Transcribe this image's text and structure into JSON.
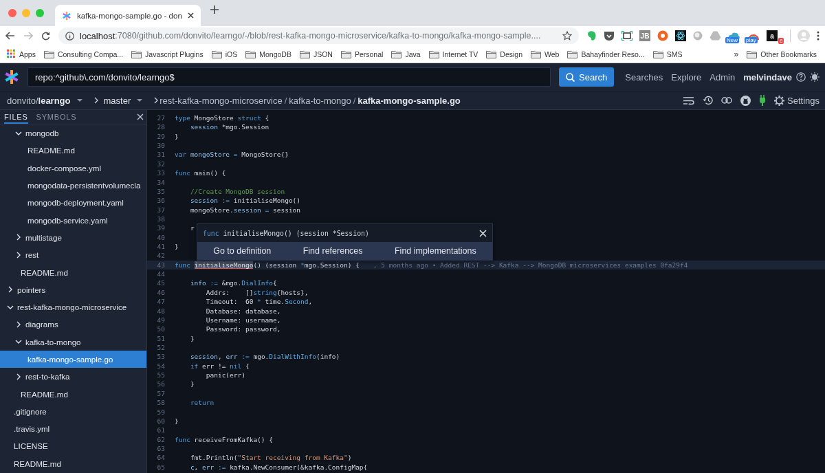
{
  "browser": {
    "tab": {
      "title": "kafka-mongo-sample.go - don"
    },
    "address": {
      "host": "localhost",
      "rest": ":7080/github.com/donvito/learngo/-/blob/rest-kafka-mongo-microservice/kafka-to-mongo/kafka-mongo-sample...."
    },
    "extensions": [
      {
        "kind": "elephant"
      },
      {
        "kind": "shield"
      },
      {
        "kind": "frame"
      },
      {
        "kind": "tile",
        "label": "JB"
      },
      {
        "kind": "lifebuoy"
      },
      {
        "kind": "atom"
      },
      {
        "kind": "orb"
      },
      {
        "kind": "triangle"
      },
      {
        "kind": "cloud",
        "badge": "New"
      },
      {
        "kind": "rainbow",
        "badge": "play"
      },
      {
        "kind": "tile",
        "label": "a",
        "badge": "8"
      }
    ],
    "bookmarks": [
      {
        "kind": "apps",
        "label": "Apps"
      },
      {
        "kind": "folder",
        "label": "Consulting Compa..."
      },
      {
        "kind": "folder",
        "label": "Javascript Plugins"
      },
      {
        "kind": "folder",
        "label": "iOS"
      },
      {
        "kind": "folder",
        "label": "MongoDB"
      },
      {
        "kind": "folder",
        "label": "JSON"
      },
      {
        "kind": "folder",
        "label": "Personal"
      },
      {
        "kind": "folder",
        "label": "Java"
      },
      {
        "kind": "folder",
        "label": "Internet TV"
      },
      {
        "kind": "folder",
        "label": "Design"
      },
      {
        "kind": "folder",
        "label": "Web"
      },
      {
        "kind": "folder",
        "label": "Bahayfinder Reso..."
      },
      {
        "kind": "folder",
        "label": "SMS"
      }
    ],
    "bookmarks_more": "»",
    "other_bookmarks": "Other Bookmarks"
  },
  "navbar": {
    "search_value": "repo:^github\\.com/donvito/learngo$",
    "search_button": "Search",
    "links": [
      "Searches",
      "Explore",
      "Admin"
    ],
    "user": "melvindave"
  },
  "repo_bar": {
    "repo": "donvito/**learngo**",
    "branch": "master",
    "path": [
      "rest-kafka-mongo-microservice",
      "kafka-to-mongo",
      "kafka-mongo-sample.go"
    ],
    "path_separator": "/",
    "settings": "Settings"
  },
  "sidebar": {
    "tabs": [
      {
        "label": "FILES",
        "selected": true
      },
      {
        "label": "SYMBOLS",
        "selected": false
      }
    ],
    "tree": [
      {
        "kind": "hidden-parent",
        "children": [
          {
            "label": "mongodb",
            "kind": "folder",
            "expanded": true,
            "selected": false,
            "children": [
              {
                "label": "README.md",
                "kind": "file",
                "selected": false
              },
              {
                "label": "docker-compose.yml",
                "kind": "file",
                "selected": false
              },
              {
                "label": "mongodata-persistentvolumecla",
                "kind": "file",
                "selected": false
              },
              {
                "label": "mongodb-deployment.yaml",
                "kind": "file",
                "selected": false
              },
              {
                "label": "mongodb-service.yaml",
                "kind": "file",
                "selected": false
              }
            ]
          },
          {
            "label": "multistage",
            "kind": "folder",
            "expanded": false,
            "selected": false
          },
          {
            "label": "rest",
            "kind": "folder",
            "expanded": false,
            "selected": false
          },
          {
            "label": "README.md",
            "kind": "file",
            "selected": false
          }
        ]
      },
      {
        "label": "pointers",
        "kind": "folder",
        "expanded": false,
        "selected": false
      },
      {
        "label": "rest-kafka-mongo-microservice",
        "kind": "folder",
        "expanded": true,
        "selected": false,
        "children": [
          {
            "label": "diagrams",
            "kind": "folder",
            "expanded": false,
            "selected": false
          },
          {
            "label": "kafka-to-mongo",
            "kind": "folder",
            "expanded": true,
            "selected": false,
            "children": [
              {
                "label": "kafka-mongo-sample.go",
                "kind": "file",
                "selected": true
              }
            ]
          },
          {
            "label": "rest-to-kafka",
            "kind": "folder",
            "expanded": false,
            "selected": false
          },
          {
            "label": "README.md",
            "kind": "file",
            "selected": false
          }
        ]
      },
      {
        "label": ".gitignore",
        "kind": "file",
        "selected": false
      },
      {
        "label": ".travis.yml",
        "kind": "file",
        "selected": false
      },
      {
        "label": "LICENSE",
        "kind": "file",
        "selected": false
      },
      {
        "label": "README.md",
        "kind": "file",
        "selected": false
      }
    ]
  },
  "code": {
    "lines": [
      {
        "number": "27",
        "highlighted": false,
        "tokens": [
          {
            "kind": "keyword",
            "text": "type"
          },
          {
            "kind": "plain",
            "text": " MongoStore "
          },
          {
            "kind": "keyword",
            "text": "struct"
          },
          {
            "kind": "plain",
            "text": " {"
          }
        ]
      },
      {
        "number": "28",
        "highlighted": false,
        "tokens": [
          {
            "kind": "variable",
            "text": "    session"
          },
          {
            "kind": "plain",
            "text": " *mgo.Session"
          }
        ]
      },
      {
        "number": "29",
        "highlighted": false,
        "tokens": [
          {
            "kind": "plain",
            "text": "}"
          }
        ]
      },
      {
        "number": "30",
        "highlighted": false
      },
      {
        "number": "31",
        "highlighted": false,
        "tokens": [
          {
            "kind": "keyword",
            "text": "var "
          },
          {
            "kind": "variable",
            "text": "mongoStore"
          },
          {
            "kind": "keyword",
            "text": " = "
          },
          {
            "kind": "plain",
            "text": "MongoStore{}"
          }
        ]
      },
      {
        "number": "32",
        "highlighted": false
      },
      {
        "number": "33",
        "highlighted": false,
        "tokens": [
          {
            "kind": "keyword",
            "text": "func"
          },
          {
            "kind": "plain",
            "text": " main() {"
          }
        ]
      },
      {
        "number": "34",
        "highlighted": false
      },
      {
        "number": "35",
        "highlighted": false,
        "tokens": [
          {
            "kind": "comment",
            "text": "    //Create MongoDB session"
          }
        ]
      },
      {
        "number": "36",
        "highlighted": false,
        "tokens": [
          {
            "kind": "variable",
            "text": "    session"
          },
          {
            "kind": "keyword",
            "text": " := "
          },
          {
            "kind": "plain",
            "text": "initialiseMongo()"
          }
        ]
      },
      {
        "number": "37",
        "highlighted": false,
        "tokens": [
          {
            "kind": "plain",
            "text": "    mongoStore."
          },
          {
            "kind": "variable",
            "text": "session"
          },
          {
            "kind": "keyword",
            "text": " = "
          },
          {
            "kind": "plain",
            "text": "session"
          }
        ]
      },
      {
        "number": "38",
        "highlighted": false
      },
      {
        "number": "39",
        "highlighted": false,
        "tokens": [
          {
            "kind": "plain",
            "text": "    r"
          }
        ]
      },
      {
        "number": "40",
        "highlighted": false
      },
      {
        "number": "41",
        "highlighted": false,
        "tokens": [
          {
            "kind": "plain",
            "text": "}"
          }
        ]
      },
      {
        "number": "42",
        "highlighted": false
      },
      {
        "number": "43",
        "highlighted": true,
        "tokens": [
          {
            "kind": "keyword",
            "text": "func "
          },
          {
            "kind": "match",
            "text": "initialiseMongo"
          },
          {
            "kind": "plain",
            "text": "() (session "
          },
          {
            "kind": "keyword",
            "text": "*"
          },
          {
            "kind": "plain",
            "text": "mgo.Session) {"
          }
        ],
        "blame": ", 5 months ago • Added REST --> Kafka --> MongoDB microservices examples 0fa29f4"
      },
      {
        "number": "44",
        "highlighted": false
      },
      {
        "number": "45",
        "highlighted": false,
        "tokens": [
          {
            "kind": "variable",
            "text": "    info"
          },
          {
            "kind": "keyword",
            "text": " := "
          },
          {
            "kind": "plain",
            "text": "&mgo."
          },
          {
            "kind": "type",
            "text": "DialInfo"
          },
          {
            "kind": "plain",
            "text": "{"
          }
        ]
      },
      {
        "number": "46",
        "highlighted": false,
        "tokens": [
          {
            "kind": "plain",
            "text": "        Addrs:    []"
          },
          {
            "kind": "type",
            "text": "string"
          },
          {
            "kind": "plain",
            "text": "{hosts},"
          }
        ]
      },
      {
        "number": "47",
        "highlighted": false,
        "tokens": [
          {
            "kind": "plain",
            "text": "        Timeout:  60 "
          },
          {
            "kind": "keyword",
            "text": "*"
          },
          {
            "kind": "plain",
            "text": " time."
          },
          {
            "kind": "type",
            "text": "Second"
          },
          {
            "kind": "plain",
            "text": ","
          }
        ]
      },
      {
        "number": "48",
        "highlighted": false,
        "tokens": [
          {
            "kind": "plain",
            "text": "        Database: database,"
          }
        ]
      },
      {
        "number": "49",
        "highlighted": false,
        "tokens": [
          {
            "kind": "plain",
            "text": "        Username: username,"
          }
        ]
      },
      {
        "number": "50",
        "highlighted": false,
        "tokens": [
          {
            "kind": "plain",
            "text": "        Password: password,"
          }
        ]
      },
      {
        "number": "51",
        "highlighted": false,
        "tokens": [
          {
            "kind": "plain",
            "text": "    }"
          }
        ]
      },
      {
        "number": "52",
        "highlighted": false
      },
      {
        "number": "53",
        "highlighted": false,
        "tokens": [
          {
            "kind": "variable",
            "text": "    session"
          },
          {
            "kind": "plain",
            "text": ", "
          },
          {
            "kind": "variable",
            "text": "err"
          },
          {
            "kind": "keyword",
            "text": " := "
          },
          {
            "kind": "plain",
            "text": "mgo."
          },
          {
            "kind": "type",
            "text": "DialWithInfo"
          },
          {
            "kind": "plain",
            "text": "(info)"
          }
        ]
      },
      {
        "number": "54",
        "highlighted": false,
        "tokens": [
          {
            "kind": "keyword",
            "text": "    if"
          },
          {
            "kind": "plain",
            "text": " err != "
          },
          {
            "kind": "keyword",
            "text": "nil"
          },
          {
            "kind": "plain",
            "text": " {"
          }
        ]
      },
      {
        "number": "55",
        "highlighted": false,
        "tokens": [
          {
            "kind": "plain",
            "text": "        panic(err)"
          }
        ]
      },
      {
        "number": "56",
        "highlighted": false,
        "tokens": [
          {
            "kind": "plain",
            "text": "    }"
          }
        ]
      },
      {
        "number": "57",
        "highlighted": false
      },
      {
        "number": "58",
        "highlighted": false,
        "tokens": [
          {
            "kind": "keyword",
            "text": "    return"
          }
        ]
      },
      {
        "number": "59",
        "highlighted": false
      },
      {
        "number": "60",
        "highlighted": false,
        "tokens": [
          {
            "kind": "plain",
            "text": "}"
          }
        ]
      },
      {
        "number": "61",
        "highlighted": false
      },
      {
        "number": "62",
        "highlighted": false,
        "tokens": [
          {
            "kind": "keyword",
            "text": "func"
          },
          {
            "kind": "plain",
            "text": " receiveFromKafka() {"
          }
        ]
      },
      {
        "number": "63",
        "highlighted": false
      },
      {
        "number": "64",
        "highlighted": false,
        "tokens": [
          {
            "kind": "plain",
            "text": "    fmt.Println("
          },
          {
            "kind": "string",
            "text": "\"Start receiving from Kafka\""
          },
          {
            "kind": "plain",
            "text": ")"
          }
        ]
      },
      {
        "number": "65",
        "highlighted": false,
        "tokens": [
          {
            "kind": "variable",
            "text": "    c"
          },
          {
            "kind": "plain",
            "text": ", "
          },
          {
            "kind": "variable",
            "text": "err"
          },
          {
            "kind": "keyword",
            "text": " := "
          },
          {
            "kind": "plain",
            "text": "kafka.NewConsumer(&kafka.ConfigMap{"
          }
        ]
      }
    ],
    "popup": {
      "signature": [
        {
          "kind": "keyword",
          "text": "func"
        },
        {
          "kind": "plain",
          "text": " initialiseMongo() (session *Session)"
        }
      ],
      "actions": [
        "Go to definition",
        "Find references",
        "Find implementations"
      ]
    }
  }
}
